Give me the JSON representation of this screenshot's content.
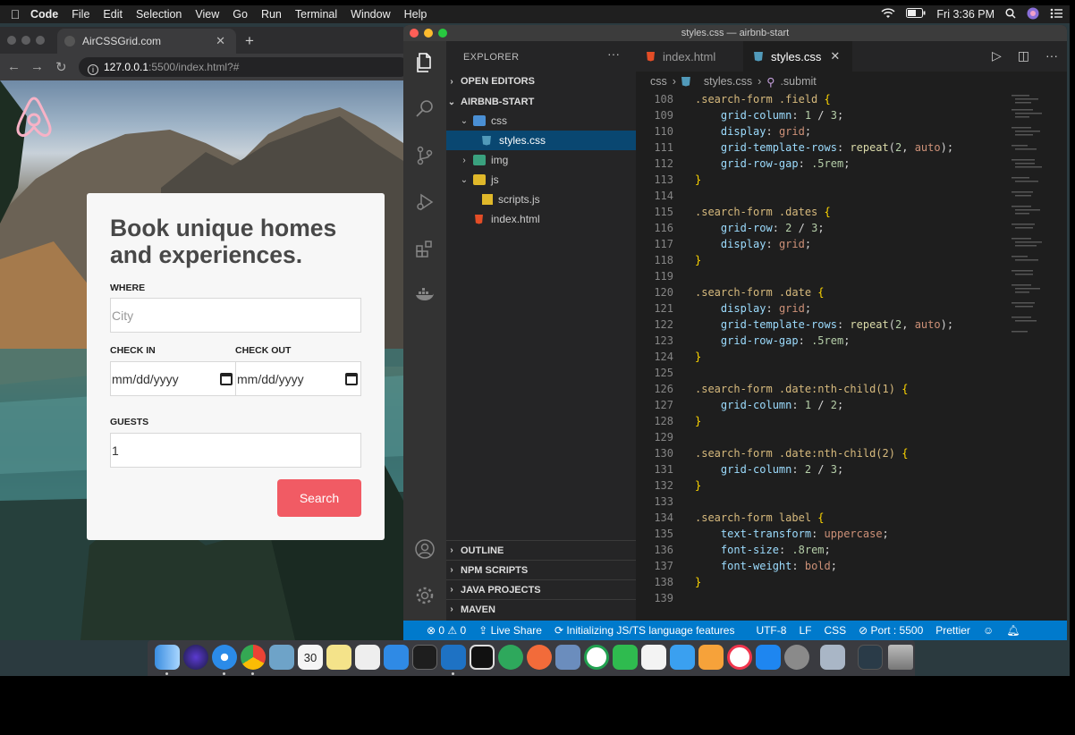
{
  "menubar": {
    "app_name": "Code",
    "items": [
      "File",
      "Edit",
      "Selection",
      "View",
      "Go",
      "Run",
      "Terminal",
      "Window",
      "Help"
    ],
    "clock": "Fri 3:36 PM"
  },
  "browser": {
    "tab_title": "AirCSSGrid.com",
    "url_host": "127.0.0.1",
    "url_path": ":5500/index.html?#"
  },
  "form": {
    "title": "Book unique homes and experiences.",
    "where_label": "WHERE",
    "where_placeholder": "City",
    "checkin_label": "CHECK IN",
    "checkout_label": "CHECK OUT",
    "checkin_value": "mm/dd/yyyy",
    "checkout_value": "mm/dd/yyyy",
    "guests_label": "GUESTS",
    "guests_value": "1",
    "search_label": "Search",
    "accent_color": "#f15b64"
  },
  "vscode": {
    "window_title": "styles.css — airbnb-start",
    "explorer_title": "EXPLORER",
    "open_editors": "OPEN EDITORS",
    "project": "AIRBNB-START",
    "tree": [
      {
        "name": "css",
        "type": "folder",
        "open": true
      },
      {
        "name": "styles.css",
        "type": "css",
        "selected": true
      },
      {
        "name": "img",
        "type": "folder",
        "open": false
      },
      {
        "name": "js",
        "type": "folder",
        "open": true
      },
      {
        "name": "scripts.js",
        "type": "js"
      },
      {
        "name": "index.html",
        "type": "html"
      }
    ],
    "bottom_sections": [
      "OUTLINE",
      "NPM SCRIPTS",
      "JAVA PROJECTS",
      "MAVEN"
    ],
    "tabs": [
      {
        "label": "index.html",
        "active": false
      },
      {
        "label": "styles.css",
        "active": true
      }
    ],
    "breadcrumb": [
      "css",
      "styles.css",
      ".submit"
    ],
    "code_lines": [
      {
        "n": "108",
        "t": ".search-form .field {"
      },
      {
        "n": "109",
        "t": "    grid-column: 1 / 3;"
      },
      {
        "n": "110",
        "t": "    display: grid;"
      },
      {
        "n": "111",
        "t": "    grid-template-rows: repeat(2, auto);"
      },
      {
        "n": "112",
        "t": "    grid-row-gap: .5rem;"
      },
      {
        "n": "113",
        "t": "}"
      },
      {
        "n": "114",
        "t": ""
      },
      {
        "n": "115",
        "t": ".search-form .dates {"
      },
      {
        "n": "116",
        "t": "    grid-row: 2 / 3;"
      },
      {
        "n": "117",
        "t": "    display: grid;"
      },
      {
        "n": "118",
        "t": "}"
      },
      {
        "n": "119",
        "t": ""
      },
      {
        "n": "120",
        "t": ".search-form .date {"
      },
      {
        "n": "121",
        "t": "    display: grid;"
      },
      {
        "n": "122",
        "t": "    grid-template-rows: repeat(2, auto);"
      },
      {
        "n": "123",
        "t": "    grid-row-gap: .5rem;"
      },
      {
        "n": "124",
        "t": "}"
      },
      {
        "n": "125",
        "t": ""
      },
      {
        "n": "126",
        "t": ".search-form .date:nth-child(1) {"
      },
      {
        "n": "127",
        "t": "    grid-column: 1 / 2;"
      },
      {
        "n": "128",
        "t": "}"
      },
      {
        "n": "129",
        "t": ""
      },
      {
        "n": "130",
        "t": ".search-form .date:nth-child(2) {"
      },
      {
        "n": "131",
        "t": "    grid-column: 2 / 3;"
      },
      {
        "n": "132",
        "t": "}"
      },
      {
        "n": "133",
        "t": ""
      },
      {
        "n": "134",
        "t": ".search-form label {"
      },
      {
        "n": "135",
        "t": "    text-transform: uppercase;"
      },
      {
        "n": "136",
        "t": "    font-size: .8rem;"
      },
      {
        "n": "137",
        "t": "    font-weight: bold;"
      },
      {
        "n": "138",
        "t": "}"
      },
      {
        "n": "139",
        "t": ""
      }
    ],
    "status": {
      "problems": "⊗ 0 ⚠ 0",
      "live_share": "Live Share",
      "js_ts": "Initializing JS/TS language features",
      "encoding": "UTF-8",
      "eol": "LF",
      "language": "CSS",
      "port": "Port : 5500",
      "formatter": "Prettier"
    }
  }
}
